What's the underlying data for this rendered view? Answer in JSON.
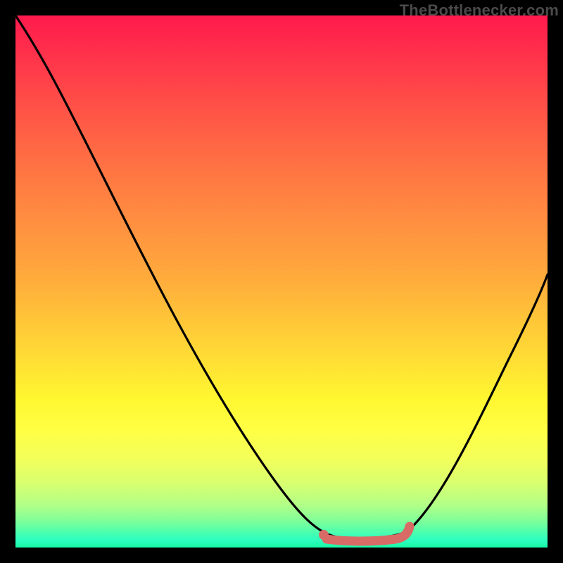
{
  "attribution": "TheBottlenecker.com",
  "colors": {
    "background": "#000000",
    "gradient_top": "#ff1a4d",
    "gradient_bottom": "#18f8a8",
    "curve_stroke": "#000000",
    "marker_fill": "#d96b66"
  },
  "chart_data": {
    "type": "line",
    "title": "",
    "xlabel": "",
    "ylabel": "",
    "xlim": [
      0,
      1
    ],
    "ylim": [
      0,
      1
    ],
    "x": [
      0.0,
      0.04,
      0.1,
      0.16,
      0.22,
      0.28,
      0.34,
      0.4,
      0.46,
      0.5,
      0.54,
      0.58,
      0.62,
      0.66,
      0.7,
      0.73,
      0.78,
      0.84,
      0.9,
      0.96,
      1.0
    ],
    "values": [
      1.0,
      0.92,
      0.8,
      0.67,
      0.55,
      0.43,
      0.31,
      0.21,
      0.13,
      0.08,
      0.045,
      0.025,
      0.012,
      0.006,
      0.004,
      0.006,
      0.03,
      0.1,
      0.22,
      0.36,
      0.46
    ],
    "annotations": [
      {
        "type": "marker_segment",
        "x_start": 0.58,
        "x_end": 0.73,
        "y_approx": 0.01
      }
    ]
  }
}
